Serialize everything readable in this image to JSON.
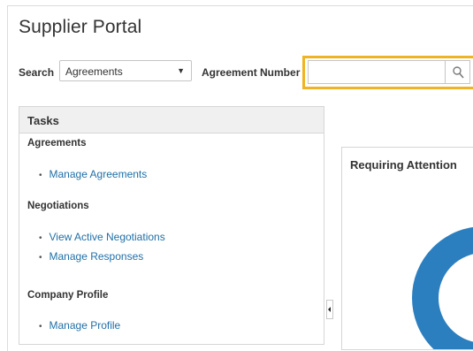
{
  "header": {
    "title": "Supplier Portal"
  },
  "search": {
    "label": "Search",
    "selected": "Agreements",
    "field_label": "Agreement Number",
    "field_value": "",
    "button_icon": "search-icon"
  },
  "tasks": {
    "title": "Tasks",
    "sections": [
      {
        "heading": "Agreements",
        "links": [
          "Manage Agreements"
        ]
      },
      {
        "heading": "Negotiations",
        "links": [
          "View Active Negotiations",
          "Manage Responses"
        ]
      },
      {
        "heading": "Company Profile",
        "links": [
          "Manage Profile"
        ]
      }
    ]
  },
  "splitter": {
    "icon": "collapse-left-icon"
  },
  "attention": {
    "title": "Requiring Attention",
    "donut_color": "#2c7fbf"
  },
  "colors": {
    "highlight": "#f0b323",
    "link": "#2170a8"
  }
}
